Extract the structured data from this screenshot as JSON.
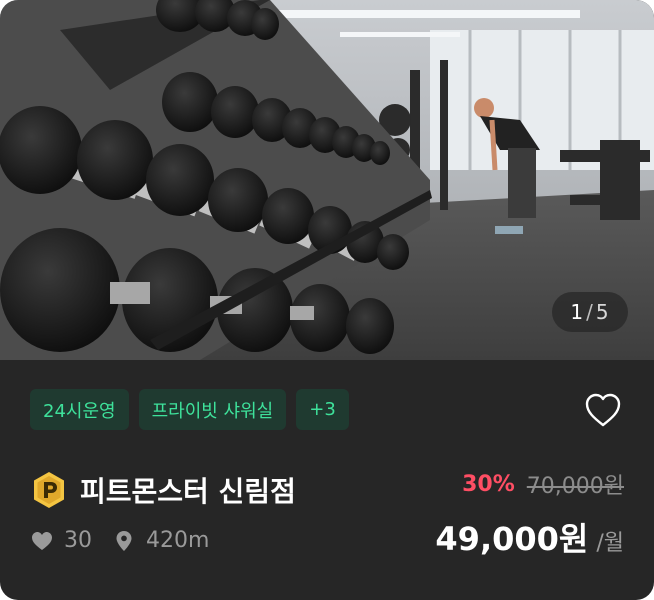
{
  "gym_card": {
    "image": {
      "page_current": "1",
      "page_separator": "/",
      "page_total": "5"
    },
    "tags": [
      "24시운영",
      "프라이빗 샤워실",
      "+3"
    ],
    "name": "피트몬스터 신림점",
    "likes": "30",
    "distance": "420m",
    "discount_rate": "30%",
    "original_price": "70,000원",
    "price": "49,000원",
    "per_unit": "/월",
    "colors": {
      "card_background": "#262626",
      "tag_background": "#1f3a30",
      "tag_text": "#3ee29b",
      "discount": "#ff4e64",
      "badge": "#f4c542"
    },
    "icons": [
      "heart-outline-icon",
      "brand-badge-icon",
      "heart-filled-icon",
      "location-pin-icon"
    ]
  }
}
